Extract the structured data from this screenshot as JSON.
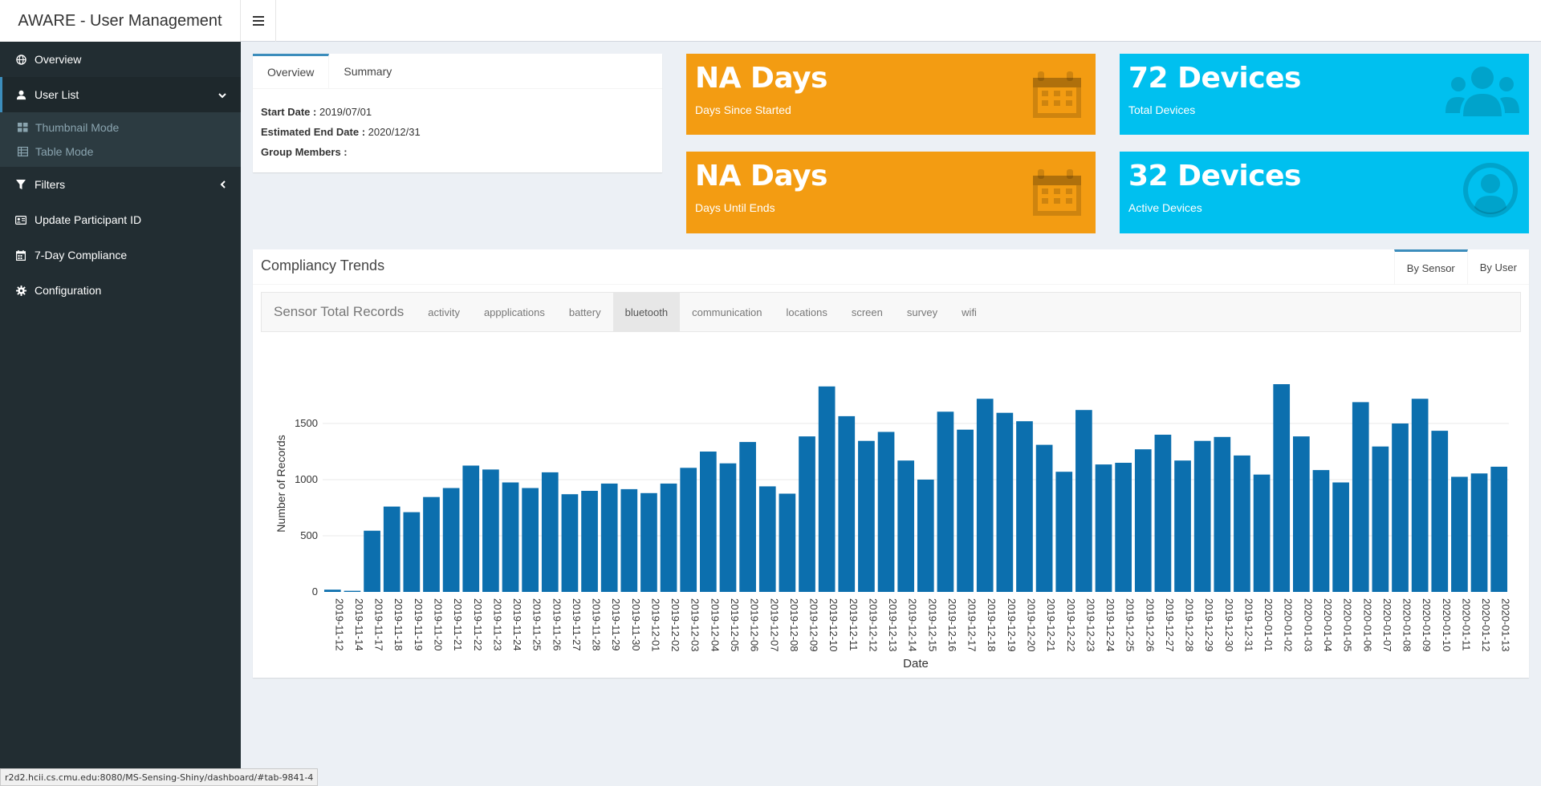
{
  "app": {
    "title": "AWARE - User Management"
  },
  "sidebar": {
    "items": [
      {
        "label": "Overview",
        "icon": "globe-icon"
      },
      {
        "label": "User List",
        "icon": "user-icon"
      },
      {
        "label": "Filters",
        "icon": "filter-icon"
      },
      {
        "label": "Update Participant ID",
        "icon": "id-card-icon"
      },
      {
        "label": "7-Day Compliance",
        "icon": "calendar-icon"
      },
      {
        "label": "Configuration",
        "icon": "gear-icon"
      }
    ],
    "sub_items": [
      {
        "label": "Thumbnail Mode",
        "icon": "grid-icon"
      },
      {
        "label": "Table Mode",
        "icon": "table-icon"
      }
    ]
  },
  "overview_card": {
    "tabs": [
      "Overview",
      "Summary"
    ],
    "start_date_label": "Start Date :",
    "start_date": "2019/07/01",
    "end_date_label": "Estimated End Date :",
    "end_date": "2020/12/31",
    "group_label": "Group Members :"
  },
  "value_boxes": [
    {
      "value": "NA Days",
      "subtitle": "Days Since Started",
      "color": "#f39c12",
      "icon": "calendar-icon"
    },
    {
      "value": "72 Devices",
      "subtitle": "Total Devices",
      "color": "#00c0ef",
      "icon": "users-icon"
    },
    {
      "value": "NA Days",
      "subtitle": "Days Until Ends",
      "color": "#f39c12",
      "icon": "calendar-icon"
    },
    {
      "value": "32 Devices",
      "subtitle": "Active Devices",
      "color": "#00c0ef",
      "icon": "user-circle-icon"
    }
  ],
  "compliancy": {
    "title": "Compliancy Trends",
    "tabs": [
      "By Sensor",
      "By User"
    ],
    "nav_title": "Sensor Total Records",
    "sensors": [
      "activity",
      "appplications",
      "battery",
      "bluetooth",
      "communication",
      "locations",
      "screen",
      "survey",
      "wifi"
    ],
    "active_sensor": "bluetooth"
  },
  "chart_data": {
    "type": "bar",
    "xlabel": "Date",
    "ylabel": "Number of Records",
    "ylim": [
      0,
      1900
    ],
    "yticks": [
      0,
      500,
      1000,
      1500
    ],
    "bar_color": "#0c6fae",
    "categories": [
      "2019-11-12",
      "2019-11-14",
      "2019-11-17",
      "2019-11-18",
      "2019-11-19",
      "2019-11-20",
      "2019-11-21",
      "2019-11-22",
      "2019-11-23",
      "2019-11-24",
      "2019-11-25",
      "2019-11-26",
      "2019-11-27",
      "2019-11-28",
      "2019-11-29",
      "2019-11-30",
      "2019-12-01",
      "2019-12-02",
      "2019-12-03",
      "2019-12-04",
      "2019-12-05",
      "2019-12-06",
      "2019-12-07",
      "2019-12-08",
      "2019-12-09",
      "2019-12-10",
      "2019-12-11",
      "2019-12-12",
      "2019-12-13",
      "2019-12-14",
      "2019-12-15",
      "2019-12-16",
      "2019-12-17",
      "2019-12-18",
      "2019-12-19",
      "2019-12-20",
      "2019-12-21",
      "2019-12-22",
      "2019-12-23",
      "2019-12-24",
      "2019-12-25",
      "2019-12-26",
      "2019-12-27",
      "2019-12-28",
      "2019-12-29",
      "2019-12-30",
      "2019-12-31",
      "2020-01-01",
      "2020-01-02",
      "2020-01-03",
      "2020-01-04",
      "2020-01-05",
      "2020-01-06",
      "2020-01-07",
      "2020-01-08",
      "2020-01-09",
      "2020-01-10",
      "2020-01-11",
      "2020-01-12",
      "2020-01-13"
    ],
    "values": [
      20,
      10,
      545,
      760,
      710,
      845,
      925,
      1125,
      1090,
      975,
      925,
      1065,
      870,
      900,
      965,
      915,
      880,
      965,
      1105,
      1250,
      1145,
      1335,
      940,
      875,
      1385,
      1830,
      1565,
      1345,
      1425,
      1170,
      1000,
      1605,
      1445,
      1720,
      1595,
      1520,
      1310,
      1070,
      1620,
      1135,
      1150,
      1270,
      1400,
      1170,
      1345,
      1380,
      1215,
      1045,
      1850,
      1385,
      1085,
      975,
      1690,
      1295,
      1500,
      1720,
      1435,
      1025,
      1055,
      1115
    ]
  },
  "status_bar": {
    "url": "r2d2.hcii.cs.cmu.edu:8080/MS-Sensing-Shiny/dashboard/#tab-9841-4"
  }
}
